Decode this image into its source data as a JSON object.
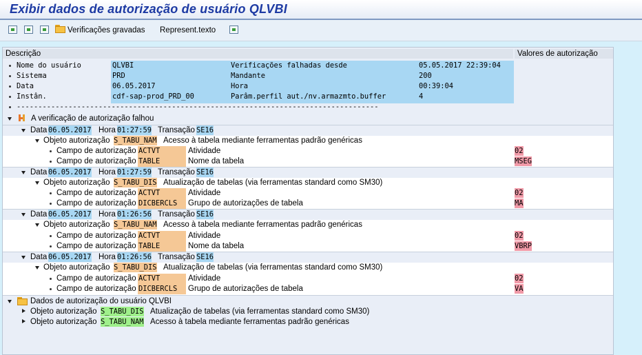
{
  "title": "Exibir dados de autorização de usuário QLVBI",
  "toolbar": {
    "icons": [
      "expand-all-icon",
      "collapse-all-icon",
      "copy-icon",
      "folder-icon",
      "export-icon"
    ],
    "saved_checks": "Verificações gravadas",
    "text_repr": "Represent.texto"
  },
  "header": {
    "col1": "Descrição",
    "col2": "Valores de autorização"
  },
  "summary": {
    "user_label": "Nome do usuário",
    "user_value": "QLVBI",
    "failed_label": "Verificações falhadas desde",
    "failed_value": "05.05.2017 22:39:04",
    "system_label": "Sistema",
    "system_value": "PRD",
    "client_label": "Mandante",
    "client_value": "200",
    "date_label": "Data",
    "date_value": "06.05.2017",
    "time_label": "Hora",
    "time_value": "00:39:04",
    "inst_label": "Instân.",
    "inst_value": "cdf-sap-prod_PRD_00",
    "param_label": "Parâm.perfil aut./nv.armazmto.buffer",
    "param_value": "4",
    "separator": "------------------------------------------------------------------------------------"
  },
  "failed_node": "A verificação de autorização falhou",
  "labels": {
    "date": "Data",
    "time": "Hora",
    "transaction": "Transação",
    "object": "Objeto autorização",
    "field": "Campo de autorização"
  },
  "checks": [
    {
      "date": "06.05.2017",
      "time": "01:27:59",
      "tcode": "SE16",
      "object": "S_TABU_NAM",
      "object_desc": "Acesso à tabela mediante ferramentas padrão genéricas",
      "fields": [
        {
          "name": "ACTVT",
          "desc": "Atividade",
          "value": "02"
        },
        {
          "name": "TABLE",
          "desc": "Nome da tabela",
          "value": "MSEG"
        }
      ]
    },
    {
      "date": "06.05.2017",
      "time": "01:27:59",
      "tcode": "SE16",
      "object": "S_TABU_DIS",
      "object_desc": "Atualização de tabelas (via ferramentas standard como SM30)",
      "fields": [
        {
          "name": "ACTVT",
          "desc": "Atividade",
          "value": "02"
        },
        {
          "name": "DICBERCLS",
          "desc": "Grupo de autorizações de tabela",
          "value": "MA"
        }
      ]
    },
    {
      "date": "06.05.2017",
      "time": "01:26:56",
      "tcode": "SE16",
      "object": "S_TABU_NAM",
      "object_desc": "Acesso à tabela mediante ferramentas padrão genéricas",
      "fields": [
        {
          "name": "ACTVT",
          "desc": "Atividade",
          "value": "02"
        },
        {
          "name": "TABLE",
          "desc": "Nome da tabela",
          "value": "VBRP"
        }
      ]
    },
    {
      "date": "06.05.2017",
      "time": "01:26:56",
      "tcode": "SE16",
      "object": "S_TABU_DIS",
      "object_desc": "Atualização de tabelas (via ferramentas standard como SM30)",
      "fields": [
        {
          "name": "ACTVT",
          "desc": "Atividade",
          "value": "02"
        },
        {
          "name": "DICBERCLS",
          "desc": "Grupo de autorizações de tabela",
          "value": "VA"
        }
      ]
    }
  ],
  "user_data_node": "Dados de autorização do usuário QLVBI",
  "user_objects": [
    {
      "label": "Objeto autorização",
      "object": "S_TABU_DIS",
      "desc": "Atualização de tabelas (via ferramentas standard como SM30)"
    },
    {
      "label": "Objeto autorização",
      "object": "S_TABU_NAM",
      "desc": "Acesso à tabela mediante ferramentas padrão genéricas"
    }
  ]
}
